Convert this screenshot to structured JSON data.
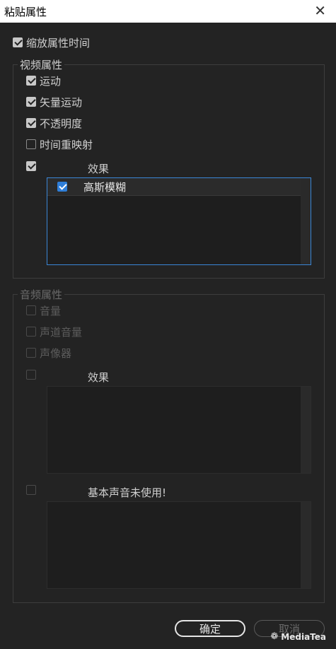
{
  "window": {
    "title": "粘贴属性",
    "close_glyph": "✕"
  },
  "scale_time": {
    "label": "缩放属性时间",
    "checked": true
  },
  "video": {
    "group_label": "视频属性",
    "items": [
      {
        "label": "运动",
        "checked": true
      },
      {
        "label": "矢量运动",
        "checked": true
      },
      {
        "label": "不透明度",
        "checked": true
      },
      {
        "label": "时间重映射",
        "checked": false
      }
    ],
    "effects": {
      "header": "效果",
      "checked": true,
      "list": [
        {
          "label": "高斯模糊",
          "checked": true
        }
      ]
    }
  },
  "audio": {
    "group_label": "音频属性",
    "items": [
      {
        "label": "音量",
        "checked": false
      },
      {
        "label": "声道音量",
        "checked": false
      },
      {
        "label": "声像器",
        "checked": false
      }
    ],
    "effects": {
      "header": "效果",
      "checked": false
    },
    "essential_sound": {
      "header": "基本声音未使用!",
      "checked": false
    }
  },
  "buttons": {
    "ok": "确定",
    "cancel": "取消"
  },
  "watermark": {
    "text": "MediaTea",
    "icon": "wechat-icon"
  },
  "colors": {
    "accent": "#3a86d6",
    "background": "#232323"
  }
}
